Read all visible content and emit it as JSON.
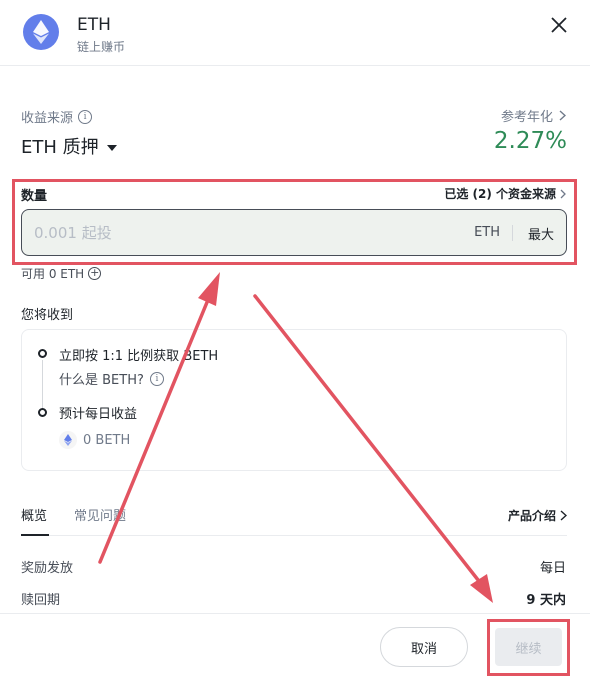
{
  "header": {
    "coin": "ETH",
    "subtitle": "链上赚币"
  },
  "source": {
    "label": "收益来源",
    "value": "ETH 质押",
    "apr_label": "参考年化",
    "apr_value": "2.27%"
  },
  "amount": {
    "label": "数量",
    "selected_sources": "已选 (2) 个资金来源",
    "placeholder": "0.001 起投",
    "unit": "ETH",
    "max": "最大",
    "available": "可用 0 ETH"
  },
  "receive": {
    "title": "您将收到",
    "step1": "立即按 1:1 比例获取 BETH",
    "step1_sub": "什么是 BETH?",
    "step2": "预计每日收益",
    "step2_value": "0 BETH"
  },
  "tabs": {
    "overview": "概览",
    "faq": "常见问题",
    "product_intro": "产品介绍"
  },
  "details": {
    "reward_label": "奖励发放",
    "reward_value": "每日",
    "redeem_label": "赎回期",
    "redeem_value": "9 天内"
  },
  "footer": {
    "cancel": "取消",
    "continue": "继续"
  },
  "colors": {
    "eth_brand": "#627eea",
    "apr_green": "#2e8b57",
    "annotation_red": "#e25461"
  }
}
